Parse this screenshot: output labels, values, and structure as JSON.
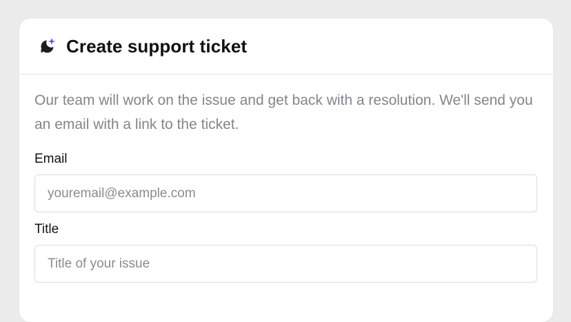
{
  "header": {
    "logo_icon": "moon-sparkle-icon",
    "title": "Create support ticket"
  },
  "description": "Our team will work on the issue and get back with a resolution. We'll send you an email with a link to the ticket.",
  "form": {
    "email": {
      "label": "Email",
      "placeholder": "youremail@example.com",
      "value": ""
    },
    "title": {
      "label": "Title",
      "placeholder": "Title of your issue",
      "value": ""
    }
  },
  "colors": {
    "accent": "#6d4aff",
    "logo_dark": "#1c1c22"
  }
}
